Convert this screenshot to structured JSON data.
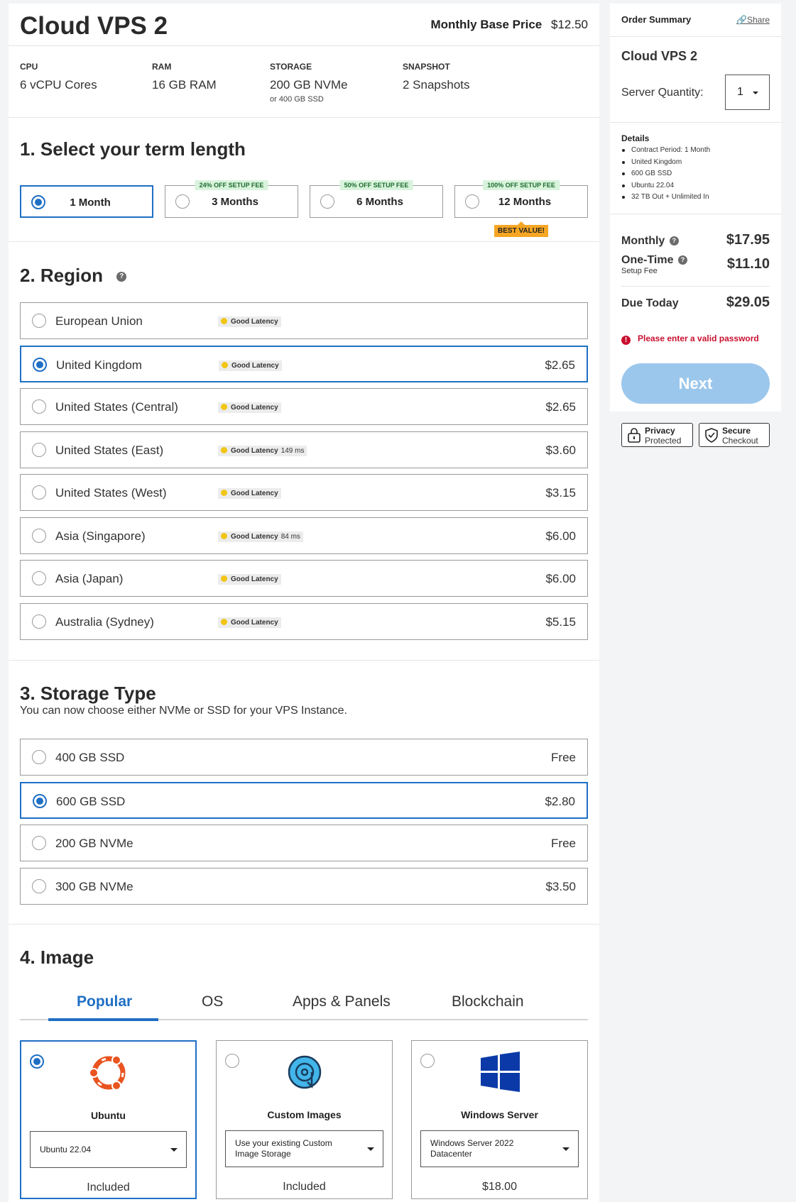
{
  "product": {
    "name": "Cloud VPS 2",
    "base_price_label": "Monthly Base Price",
    "base_price": "$12.50"
  },
  "specs": [
    {
      "key": "CPU",
      "value": "6 vCPU Cores",
      "sub": ""
    },
    {
      "key": "RAM",
      "value": "16 GB RAM",
      "sub": ""
    },
    {
      "key": "STORAGE",
      "value": "200 GB NVMe",
      "sub": "or 400 GB SSD"
    },
    {
      "key": "SNAPSHOT",
      "value": "2 Snapshots",
      "sub": ""
    }
  ],
  "term": {
    "title": "1. Select your term length",
    "options": [
      {
        "label": "1 Month",
        "promo": "",
        "selected": true
      },
      {
        "label": "3 Months",
        "promo": "24% OFF SETUP FEE",
        "selected": false
      },
      {
        "label": "6 Months",
        "promo": "50% OFF SETUP FEE",
        "selected": false
      },
      {
        "label": "12 Months",
        "promo": "100% OFF SETUP FEE",
        "selected": false,
        "badge": "BEST VALUE!"
      }
    ]
  },
  "region": {
    "title": "2. Region",
    "help_icon": "question-circle-icon",
    "latency_label": "Good Latency",
    "latency_color": "#f2c516",
    "options": [
      {
        "name": "European Union",
        "ms": "",
        "price": "",
        "selected": false
      },
      {
        "name": "United Kingdom",
        "ms": "",
        "price": "$2.65",
        "selected": true
      },
      {
        "name": "United States (Central)",
        "ms": "",
        "price": "$2.65",
        "selected": false
      },
      {
        "name": "United States (East)",
        "ms": "149 ms",
        "price": "$3.60",
        "selected": false
      },
      {
        "name": "United States (West)",
        "ms": "",
        "price": "$3.15",
        "selected": false
      },
      {
        "name": "Asia (Singapore)",
        "ms": "84 ms",
        "price": "$6.00",
        "selected": false
      },
      {
        "name": "Asia (Japan)",
        "ms": "",
        "price": "$6.00",
        "selected": false
      },
      {
        "name": "Australia (Sydney)",
        "ms": "",
        "price": "$5.15",
        "selected": false
      }
    ]
  },
  "storage": {
    "title": "3. Storage Type",
    "subtitle": "You can now choose either NVMe or SSD for your VPS Instance.",
    "options": [
      {
        "name": "400 GB SSD",
        "price": "Free",
        "selected": false
      },
      {
        "name": "600 GB SSD",
        "price": "$2.80",
        "selected": true
      },
      {
        "name": "200 GB NVMe",
        "price": "Free",
        "selected": false
      },
      {
        "name": "300 GB NVMe",
        "price": "$3.50",
        "selected": false
      }
    ]
  },
  "image": {
    "title": "4. Image",
    "tabs": [
      "Popular",
      "OS",
      "Apps & Panels",
      "Blockchain"
    ],
    "active_tab": "Popular",
    "cards": [
      {
        "name": "Ubuntu",
        "icon": "ubuntu-logo-icon",
        "select": "Ubuntu 22.04",
        "price": "Included",
        "selected": true
      },
      {
        "name": "Custom Images",
        "icon": "custom-image-disc-icon",
        "select": "Use your existing Custom Image Storage",
        "price": "Included",
        "selected": false
      },
      {
        "name": "Windows Server",
        "icon": "windows-logo-icon",
        "select": "Windows Server 2022 Datacenter",
        "price": "$18.00",
        "selected": false
      }
    ]
  },
  "summary": {
    "title": "Order Summary",
    "share": "Share",
    "product_name": "Cloud VPS 2",
    "quantity_label": "Server Quantity:",
    "quantity": "1",
    "details_title": "Details",
    "details": [
      "Contract Period: 1 Month",
      "United Kingdom",
      "600 GB SSD",
      "Ubuntu 22.04",
      "32 TB Out + Unlimited In"
    ],
    "monthly_label": "Monthly",
    "monthly": "$17.95",
    "onetime_label": "One-Time",
    "onetime_sub": "Setup Fee",
    "onetime": "$11.10",
    "due_label": "Due Today",
    "due": "$29.05",
    "error": "Please enter a valid password",
    "next": "Next"
  },
  "trust": [
    {
      "line1": "Privacy",
      "line2": "Protected",
      "icon": "lock-icon"
    },
    {
      "line1": "Secure",
      "line2": "Checkout",
      "icon": "shield-check-icon"
    }
  ],
  "colors": {
    "accent": "#1f6fc4",
    "next_button": "#9cc7ec",
    "error": "#c8102e",
    "promo_bg": "#d8f3dc",
    "best_value": "#f6a623"
  }
}
